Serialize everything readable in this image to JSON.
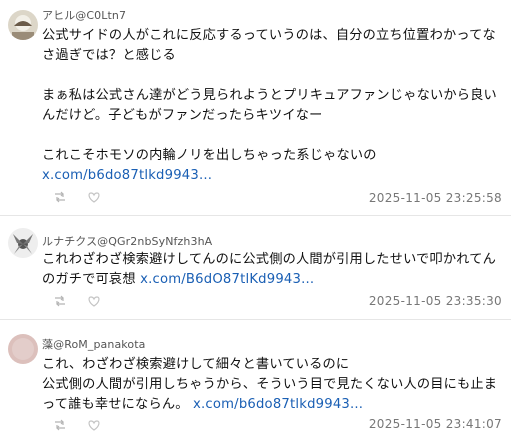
{
  "posts": [
    {
      "handle": "アヒル@C0Ltn7",
      "lines": [
        "公式サイドの人がこれに反応するっていうのは、自分の立ち位置わかってな",
        "さ過ぎでは？と感じる",
        "",
        "まぁ私は公式さん達がどう見られようとプリキュアファンじゃないから良い",
        "んだけど。子どもがファンだったらキツイなー",
        "",
        "これこそホモソの内輪ノリを出しちゃった系じゃないの"
      ],
      "link_text": "x.com/b6do87tlkd9943...",
      "timestamp": "2025-11-05 23:25:58"
    },
    {
      "handle": "ルナチクス@QGr2nbSyNfzh3hA",
      "lines": [
        "これわざわざ検索避けしてんのに公式側の人間が引用したせいで叩かれてん"
      ],
      "last_line_text": "のガチで可哀想",
      "link_text": "x.com/B6dO87tlKd9943...",
      "timestamp": "2025-11-05 23:35:30"
    },
    {
      "handle": "藻@RoM_panakota",
      "lines": [
        "これ、わざわざ検索避けして細々と書いているのに",
        "公式側の人間が引用しちゃうから、そういう目で見たくない人の目にも止ま"
      ],
      "last_line_text": "って誰も幸せにならん。",
      "link_text": "x.com/b6do87tlkd9943...",
      "timestamp": "2025-11-05 23:41:07"
    }
  ],
  "icons": {
    "repost": "repost-icon",
    "like": "heart-icon"
  }
}
